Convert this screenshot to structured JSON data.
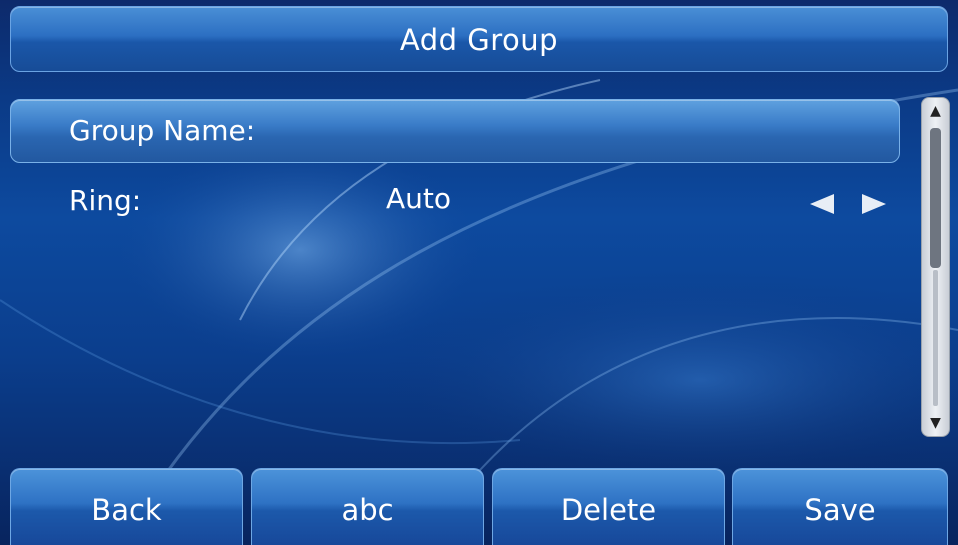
{
  "header": {
    "title": "Add Group"
  },
  "form": {
    "fields": [
      {
        "label": "Group Name:",
        "value": ""
      },
      {
        "label": "Ring:",
        "value": "Auto"
      }
    ]
  },
  "icons": {
    "left_arrow": "left-arrow-icon",
    "right_arrow": "right-arrow-icon",
    "scroll_up": "scroll-up-arrow-icon",
    "scroll_down": "scroll-down-arrow-icon"
  },
  "softkeys": [
    {
      "label": "Back"
    },
    {
      "label": "abc"
    },
    {
      "label": "Delete"
    },
    {
      "label": "Save"
    }
  ],
  "colors": {
    "background": "#0b3e8d",
    "accent": "#2e72c4",
    "text": "#ffffff"
  }
}
